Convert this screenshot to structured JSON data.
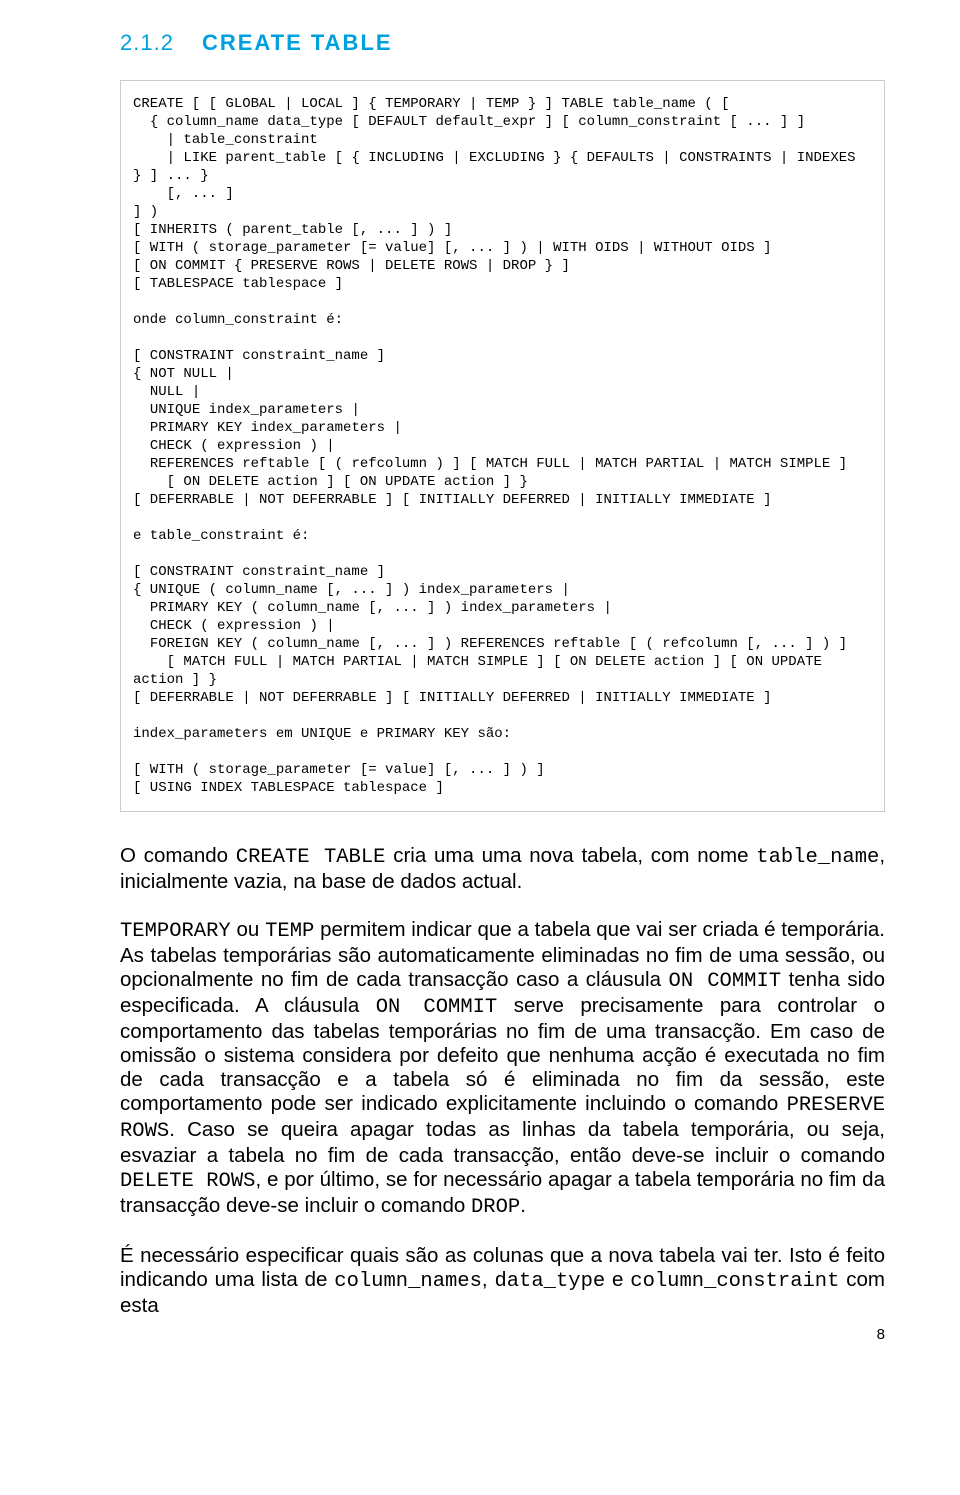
{
  "heading": {
    "number": "2.1.2",
    "title": "CREATE TABLE"
  },
  "codeBlock": "CREATE [ [ GLOBAL | LOCAL ] { TEMPORARY | TEMP } ] TABLE table_name ( [\n  { column_name data_type [ DEFAULT default_expr ] [ column_constraint [ ... ] ]\n    | table_constraint\n    | LIKE parent_table [ { INCLUDING | EXCLUDING } { DEFAULTS | CONSTRAINTS | INDEXES } ] ... }\n    [, ... ]\n] )\n[ INHERITS ( parent_table [, ... ] ) ]\n[ WITH ( storage_parameter [= value] [, ... ] ) | WITH OIDS | WITHOUT OIDS ]\n[ ON COMMIT { PRESERVE ROWS | DELETE ROWS | DROP } ]\n[ TABLESPACE tablespace ]\n\nonde column_constraint é:\n\n[ CONSTRAINT constraint_name ]\n{ NOT NULL |\n  NULL |\n  UNIQUE index_parameters |\n  PRIMARY KEY index_parameters |\n  CHECK ( expression ) |\n  REFERENCES reftable [ ( refcolumn ) ] [ MATCH FULL | MATCH PARTIAL | MATCH SIMPLE ]\n    [ ON DELETE action ] [ ON UPDATE action ] }\n[ DEFERRABLE | NOT DEFERRABLE ] [ INITIALLY DEFERRED | INITIALLY IMMEDIATE ]\n\ne table_constraint é:\n\n[ CONSTRAINT constraint_name ]\n{ UNIQUE ( column_name [, ... ] ) index_parameters |\n  PRIMARY KEY ( column_name [, ... ] ) index_parameters |\n  CHECK ( expression ) |\n  FOREIGN KEY ( column_name [, ... ] ) REFERENCES reftable [ ( refcolumn [, ... ] ) ]\n    [ MATCH FULL | MATCH PARTIAL | MATCH SIMPLE ] [ ON DELETE action ] [ ON UPDATE action ] }\n[ DEFERRABLE | NOT DEFERRABLE ] [ INITIALLY DEFERRED | INITIALLY IMMEDIATE ]\n\nindex_parameters em UNIQUE e PRIMARY KEY são:\n\n[ WITH ( storage_parameter [= value] [, ... ] ) ]\n[ USING INDEX TABLESPACE tablespace ]",
  "paragraphs": {
    "p1": {
      "t1": "O comando ",
      "m1": "CREATE TABLE",
      "t2": " cria uma uma nova tabela, com nome ",
      "m2": "table_name",
      "t3": ", inicialmente vazia, na base de dados actual."
    },
    "p2": {
      "m1": "TEMPORARY",
      "t1": " ou ",
      "m2": "TEMP",
      "t2": "  permitem indicar que a tabela que vai ser criada é temporária. As tabelas temporárias são automaticamente eliminadas no fim de uma sessão, ou opcionalmente no fim de cada transacção caso a cláusula ",
      "m3": "ON COMMIT",
      "t3": " tenha sido especificada. A cláusula ",
      "m4": "ON COMMIT",
      "t4": " serve precisamente para controlar o comportamento das tabelas temporárias no fim de uma transacção. Em caso de omissão o sistema considera por defeito que nenhuma acção é executada no fim de cada transacção e a tabela só é eliminada no fim da sessão, este comportamento pode ser indicado explicitamente incluindo o comando ",
      "m5": "PRESERVE ROWS",
      "t5": ". Caso se queira apagar todas as linhas da tabela temporária, ou seja, esvaziar a tabela no fim de cada transacção, então deve-se incluir o comando ",
      "m6": "DELETE ROWS",
      "t6": ", e por último, se for necessário apagar a tabela temporária no fim da transacção deve-se incluir o comando ",
      "m7": "DROP",
      "t7": "."
    },
    "p3": {
      "t1": "É necessário especificar quais são as colunas que a nova tabela vai ter. Isto é feito indicando uma lista de ",
      "m1": "column_names",
      "t2": ", ",
      "m2": "data_type",
      "t3": " e ",
      "m3": "column_constraint",
      "t4": " com esta"
    }
  },
  "pageNumber": "8"
}
